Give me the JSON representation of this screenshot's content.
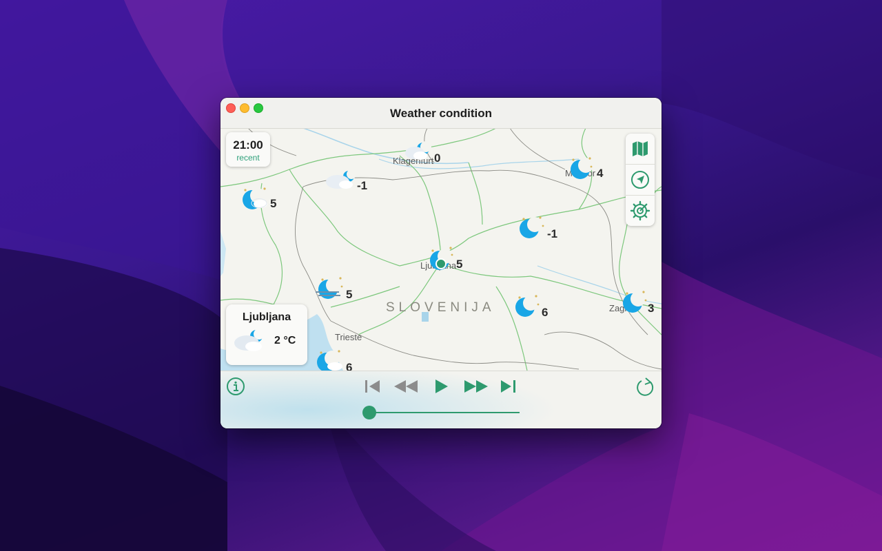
{
  "window": {
    "title": "Weather condition"
  },
  "timecard": {
    "time": "21:00",
    "status": "recent"
  },
  "cities": {
    "klagenfurt": "Klagenfurt",
    "maribor": "Maribor",
    "ljubljana": "Ljubljana",
    "zagreb": "Zagreb",
    "trieste": "Trieste"
  },
  "country": "SLOVENIJA",
  "stations": [
    {
      "id": "klagenfurt",
      "temp": "0",
      "icon": "cloud-moon-icon"
    },
    {
      "id": "villach",
      "temp": "-1",
      "icon": "cloud-moon-icon"
    },
    {
      "id": "west",
      "temp": "5",
      "icon": "moon-cloud-icon"
    },
    {
      "id": "maribor",
      "temp": "4",
      "icon": "moon-stars-icon"
    },
    {
      "id": "celje",
      "temp": "-1",
      "icon": "moon-stars-icon"
    },
    {
      "id": "ljubljana",
      "temp": "5",
      "icon": "moon-stars-icon"
    },
    {
      "id": "postojna",
      "temp": "5",
      "icon": "moon-fog-icon"
    },
    {
      "id": "novo-mesto",
      "temp": "6",
      "icon": "moon-stars-icon"
    },
    {
      "id": "zagreb",
      "temp": "3",
      "icon": "moon-stars-icon"
    },
    {
      "id": "koper",
      "temp": "6",
      "icon": "moon-cloud-icon"
    }
  ],
  "citycard": {
    "name": "Ljubljana",
    "temp": "2 °C",
    "icon": "cloud-moon-icon"
  },
  "sidebar": {
    "icons": [
      "map-icon",
      "location-arrow-icon",
      "settings-gear-icon"
    ]
  },
  "player": {
    "controls": [
      "info-icon",
      "skip-to-start-icon",
      "rewind-icon",
      "play-icon",
      "fast-forward-icon",
      "skip-to-end-icon",
      "refresh-icon"
    ],
    "progress": 0.0
  },
  "colors": {
    "accent": "#2e9a6e",
    "moon": "#19a6e6",
    "water": "#bfe0f0",
    "border": "#7cc77c"
  }
}
